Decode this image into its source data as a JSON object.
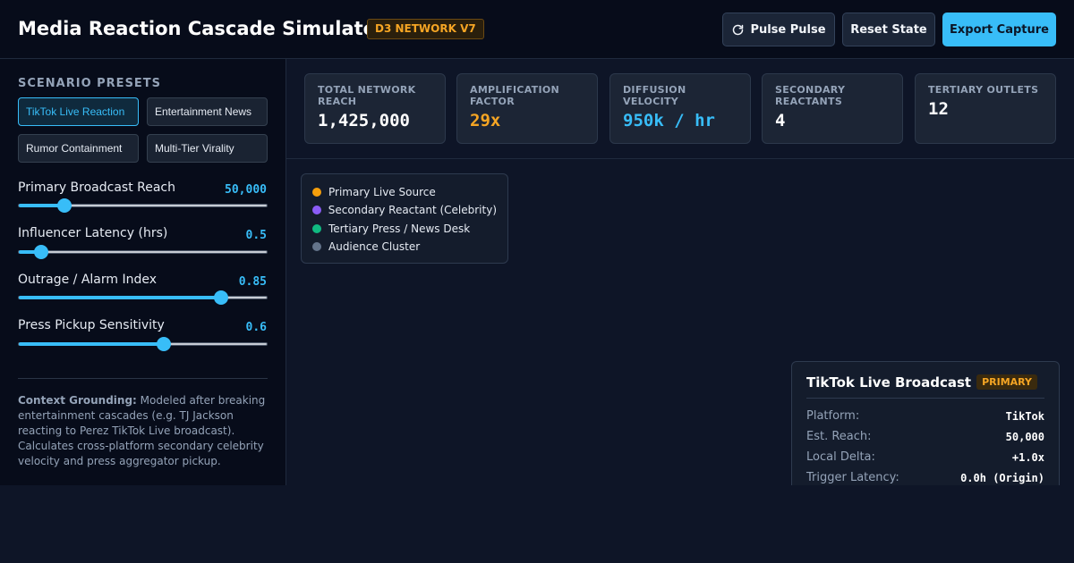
{
  "header": {
    "title": "Media Reaction Cascade Simulator",
    "badge": "D3 NETWORK V7",
    "buttons": {
      "pulse": "Pulse Pulse",
      "reset": "Reset State",
      "export": "Export Capture"
    }
  },
  "sidebar": {
    "presets_heading": "SCENARIO PRESETS",
    "presets": [
      {
        "label": "TikTok Live Reaction",
        "active": true
      },
      {
        "label": "Entertainment News",
        "active": false
      },
      {
        "label": "Rumor Containment",
        "active": false
      },
      {
        "label": "Multi-Tier Virality",
        "active": false
      }
    ],
    "sliders": [
      {
        "label": "Primary Broadcast Reach",
        "value": "50,000",
        "fraction": 0.185
      },
      {
        "label": "Influencer Latency (hrs)",
        "value": "0.5",
        "fraction": 0.09
      },
      {
        "label": "Outrage / Alarm Index",
        "value": "0.85",
        "fraction": 0.815
      },
      {
        "label": "Press Pickup Sensitivity",
        "value": "0.6",
        "fraction": 0.585
      }
    ],
    "context": {
      "label": "Context Grounding:",
      "text": " Modeled after breaking entertainment cascades (e.g. TJ Jackson reacting to Perez TikTok Live broadcast). Calculates cross-platform secondary celebrity velocity and press aggregator pickup."
    }
  },
  "stats": [
    {
      "label": "TOTAL NETWORK REACH",
      "value": "1,425,000",
      "color": "#ffffff"
    },
    {
      "label": "AMPLIFICATION FACTOR",
      "value": "29x",
      "color": "#f5a524"
    },
    {
      "label": "DIFFUSION VELOCITY",
      "value": "950k / hr",
      "color": "#38bdf8"
    },
    {
      "label": "SECONDARY REACTANTS",
      "value": "4",
      "color": "#ffffff"
    },
    {
      "label": "TERTIARY OUTLETS",
      "value": "12",
      "color": "#ffffff"
    }
  ],
  "legend": [
    {
      "label": "Primary Live Source",
      "color": "#f59e0b"
    },
    {
      "label": "Secondary Reactant (Celebrity)",
      "color": "#8b5cf6"
    },
    {
      "label": "Tertiary Press / News Desk",
      "color": "#10b981"
    },
    {
      "label": "Audience Cluster",
      "color": "#64748b"
    }
  ],
  "detail": {
    "title": "TikTok Live Broadcast",
    "badge": "PRIMARY",
    "rows": [
      {
        "key": "Platform:",
        "value": "TikTok"
      },
      {
        "key": "Est. Reach:",
        "value": "50,000"
      },
      {
        "key": "Local Delta:",
        "value": "+1.0x"
      },
      {
        "key": "Trigger Latency:",
        "value": "0.0h (Origin)"
      }
    ]
  },
  "icons": {
    "pulse_button_icon": "refresh-icon"
  }
}
